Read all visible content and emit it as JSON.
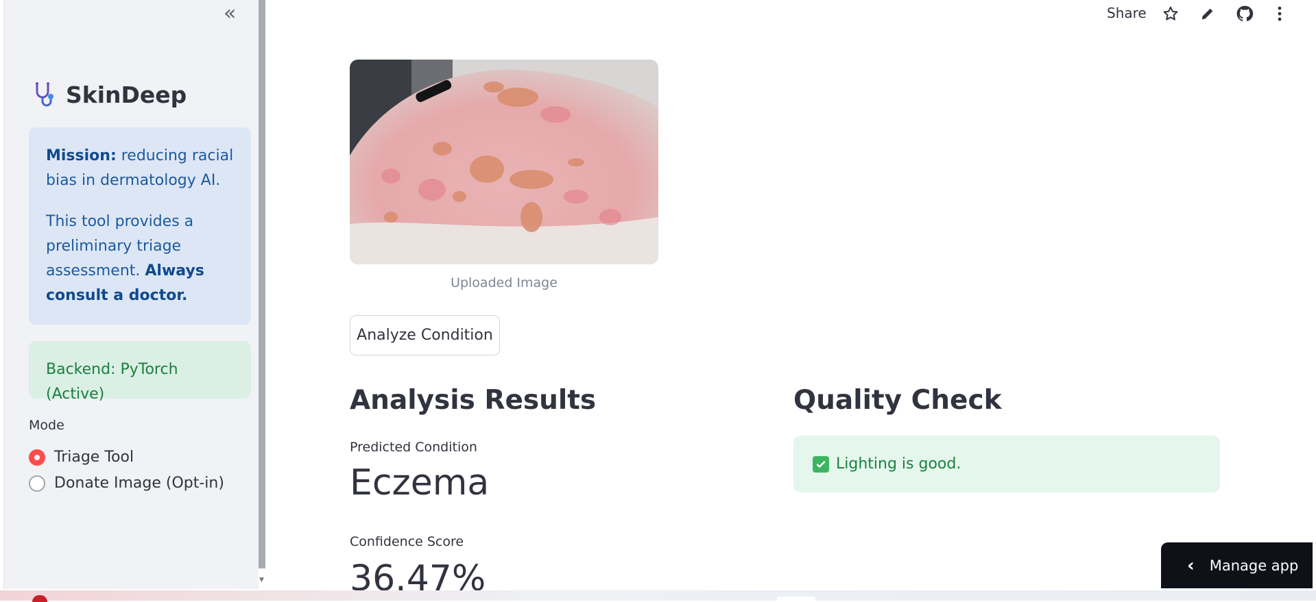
{
  "sidebar": {
    "app_title": "SkinDeep",
    "info": {
      "mission_label": "Mission:",
      "mission_text": "reducing racial bias in dermatology AI.",
      "tool_text": "This tool provides a preliminary triage assessment.",
      "warning": "Always consult a doctor."
    },
    "backend_status": "Backend: PyTorch (Active)",
    "mode": {
      "label": "Mode",
      "options": [
        {
          "label": "Triage Tool",
          "selected": true
        },
        {
          "label": "Donate Image (Opt-in)",
          "selected": false
        }
      ]
    }
  },
  "toolbar": {
    "share_label": "Share",
    "icons": [
      "star-icon",
      "edit-icon",
      "github-icon",
      "more-icon"
    ]
  },
  "main": {
    "image_caption": "Uploaded Image",
    "analyze_button": "Analyze Condition",
    "results": {
      "heading": "Analysis Results",
      "predicted_label": "Predicted Condition",
      "predicted_value": "Eczema",
      "confidence_label": "Confidence Score",
      "confidence_value": "36.47%"
    },
    "quality": {
      "heading": "Quality Check",
      "message": "Lighting is good."
    }
  },
  "manage_app": "Manage app",
  "colors": {
    "accent": "#ff4b4b",
    "info_bg": "#dde6f5",
    "info_text": "#1c5a9e",
    "success_bg": "#dbefe4",
    "success_text": "#1b7f3f"
  }
}
